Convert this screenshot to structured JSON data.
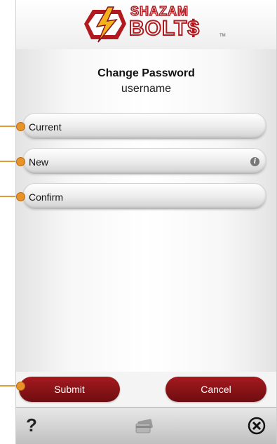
{
  "header": {
    "logo_line1": "SHAZAM",
    "logo_line2": "BOLT$",
    "logo_tm": "TM"
  },
  "page": {
    "title": "Change Password",
    "username": "username"
  },
  "form": {
    "current_label": "Current",
    "new_label": "New",
    "confirm_label": "Confirm",
    "info_icon": "i"
  },
  "buttons": {
    "submit": "Submit",
    "cancel": "Cancel"
  },
  "bottom_bar": {
    "help": "?"
  },
  "colors": {
    "brand_red": "#b11b20",
    "button_red": "#8a1216",
    "callout": "#e8932a"
  }
}
